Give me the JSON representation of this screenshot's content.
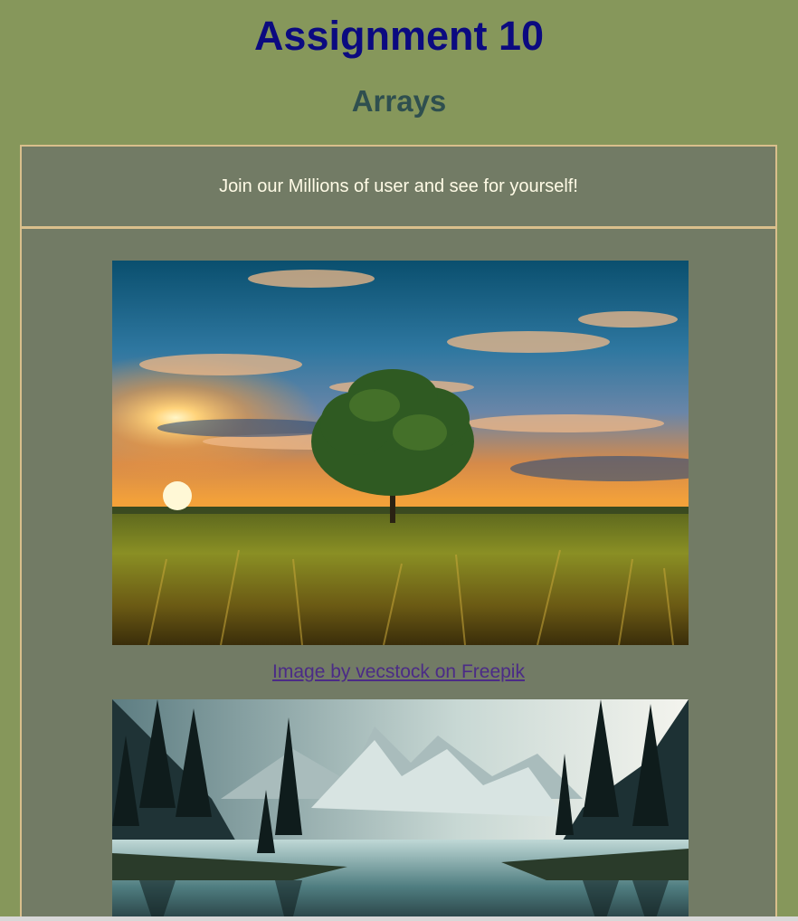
{
  "header": {
    "title": "Assignment 10",
    "subtitle": "Arrays"
  },
  "banner": {
    "text": "Join our Millions of user and see for yourself!"
  },
  "gallery": {
    "items": [
      {
        "image_icon": "sunset-tree-field-photo",
        "credit": "Image by vecstock on Freepik"
      },
      {
        "image_icon": "mountain-lake-forest-photo",
        "credit": ""
      }
    ]
  },
  "colors": {
    "page_bg": "#86975b",
    "panel_bg": "#727b65",
    "border": "#d9bf8c",
    "title": "#0b0a80",
    "subtitle": "#2f4f4f",
    "link": "#4b2b86"
  }
}
